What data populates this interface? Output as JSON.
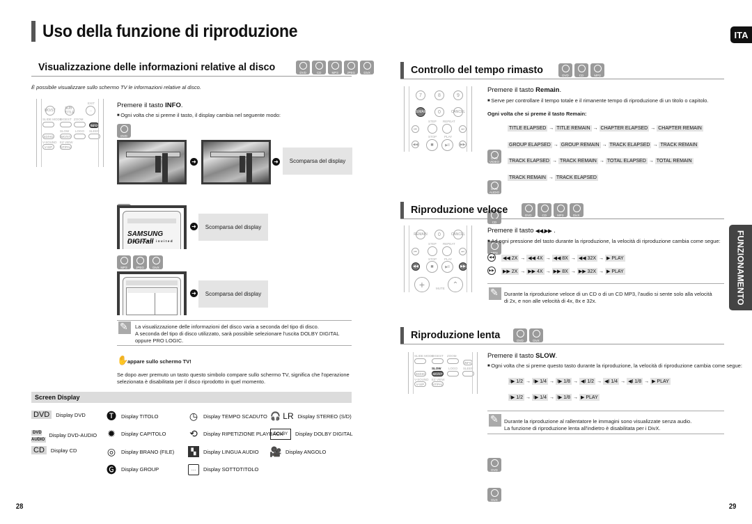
{
  "page": {
    "title": "Uso della funzione di riproduzione",
    "lang_tab": "ITA",
    "side_tab": "FUNZIONAMENTO",
    "page_left": "28",
    "page_right": "29"
  },
  "info_section": {
    "title": "Visualizzazione delle informazioni relative al disco",
    "discs": [
      "DVD",
      "CD",
      "MP3",
      "JPEG",
      "DivX"
    ],
    "intro": "È possibile visualizzare sullo schermo TV le informazioni relative al disco.",
    "press_prefix": "Premere il tasto ",
    "press_key": "INFO",
    "press_suffix": ".",
    "bullet": "Ogni volta che si preme il tasto, il display cambia nel seguente modo:",
    "dvd_label": "DVD",
    "cd_label": "CD",
    "mp3_discs": [
      "MP3",
      "JPEG",
      "DivX"
    ],
    "disappear": "Scomparsa del display",
    "samsung_logo": "SAMSUNG DIGITall",
    "samsung_tagline": "everyone's invited",
    "remote": {
      "mo_st": "MO/ST",
      "subtitle": "SUB TITLE",
      "exit": "EXIT",
      "slide_mode": "SLIDE MODE",
      "digest": "DIGEST",
      "zoom": "ZOOM",
      "info": "INFO",
      "tuner_memory": "TUNER MEMORY",
      "slow": "SLOW",
      "logo": "LOGO",
      "sleep": "SLEEP",
      "sd_hd": "SD/HD",
      "mo_st2": "MO/ST",
      "v_sound": "V-SOUND",
      "ez_view": "EZ VIEW",
      "v_sp": "V-S/P",
      "ntpal": "NT/PAL"
    },
    "notes": [
      "La visualizzazione delle informazioni del disco varia a seconda del tipo di disco.",
      "A seconda del tipo di disco utilizzato, sarà possibile selezionare l'uscita DOLBY DIGITAL oppure PRO LOGIC."
    ],
    "hand_title": "appare sullo schermo TV!",
    "hand_text": "Se dopo aver premuto un tasto questo simbolo compare sullo schermo TV, significa che l'operazione selezionata è disabilitata per il disco riprodotto in quel momento."
  },
  "screen_display": {
    "title": "Screen Display",
    "items": [
      {
        "icon": "DVD",
        "label": "Display DVD"
      },
      {
        "icon": "DVD AUDIO",
        "label": "Display DVD-AUDIO"
      },
      {
        "icon": "CD",
        "label": "Display CD"
      },
      {
        "icon": "title-icon",
        "label": "Display TITOLO"
      },
      {
        "icon": "chapter-icon",
        "label": "Display CAPITOLO"
      },
      {
        "icon": "track-icon",
        "label": "Display BRANO (FILE)"
      },
      {
        "icon": "group-icon",
        "label": "Display GROUP"
      },
      {
        "icon": "clock-icon",
        "label": "Display TEMPO SCADUTO"
      },
      {
        "icon": "repeat-icon",
        "label": "Display RIPETIZIONE PLAYBACK"
      },
      {
        "icon": "audio-language-icon",
        "label": "Display LINGUA AUDIO"
      },
      {
        "icon": "subtitle-icon",
        "label": "Display SOTTOTITOLO"
      },
      {
        "icon": "LR",
        "label": "Display STEREO (S/D)"
      },
      {
        "icon": "dolby-digital-icon",
        "label": "Display DOLBY DIGITAL"
      },
      {
        "icon": "camera-icon",
        "label": "Display ANGOLO"
      }
    ]
  },
  "remain_section": {
    "title": "Controllo del tempo rimasto",
    "discs": [
      "DVD",
      "CD",
      "MP3"
    ],
    "press_prefix": "Premere il tasto ",
    "press_key": "Remain",
    "press_suffix": ".",
    "bullet": "Serve per controllare il tempo totale e il rimanente tempo di riproduzione di un titolo o capitolo.",
    "subhead": "Ogni volta che si preme il tasto Remain:",
    "rows": [
      {
        "disc": "DVD VIDEO",
        "steps": [
          "TITLE ELAPSED",
          "TITLE REMAIN",
          "CHAPTER ELAPSED",
          "CHAPTER REMAIN"
        ]
      },
      {
        "disc": "DVD AUDIO",
        "steps": [
          "GROUP ELAPSED",
          "GROUP REMAIN",
          "TRACK ELAPSED",
          "TRACK REMAIN"
        ]
      },
      {
        "disc": "CD",
        "steps": [
          "TRACK ELAPSED",
          "TRACK REMAIN",
          "TOTAL ELAPSED",
          "TOTAL REMAIN"
        ]
      },
      {
        "disc": "MP3",
        "steps": [
          "TRACK REMAIN",
          "TRACK ELAPSED"
        ]
      }
    ],
    "remote": {
      "k7": "7",
      "k8": "8",
      "k9": "9",
      "remain": "REMAIN",
      "k0": "0",
      "cancel": "CANCEL",
      "step": "STEP",
      "repeat": "REPEAT",
      "stop": "STOP",
      "play": "PLAY"
    }
  },
  "fast_section": {
    "title": "Riproduzione veloce",
    "discs": [
      "DVD",
      "CD",
      "MP3",
      "DivX"
    ],
    "press_prefix": "Premere il tasto ",
    "press_key": "◀◀,▶▶",
    "press_suffix": " .",
    "bullet": "Ad ogni pressione del tasto durante la riproduzione, la velocità di riproduzione cambia come segue:",
    "rew_steps": [
      "◀◀ 2X",
      "◀◀ 4X",
      "◀◀ 8X",
      "◀◀ 32X",
      "▶ PLAY"
    ],
    "ff_steps": [
      "▶▶ 2X",
      "▶▶ 4X",
      "▶▶ 8X",
      "▶▶ 32X",
      "▶ PLAY"
    ],
    "note": "Durante la riproduzione veloce di un CD o di un CD MP3, l'audio si sente solo alla velocità di 2x, e non alle velocità di 4x, 8x e 32x.",
    "remote": {
      "remain": "REMAIN",
      "k0": "0",
      "cancel": "CANCEL",
      "step": "STEP",
      "repeat": "REPEAT",
      "stop": "STOP",
      "play": "PLAY",
      "mute": "MUTE"
    }
  },
  "slow_section": {
    "title": "Riproduzione lenta",
    "discs": [
      "DVD",
      "DivX"
    ],
    "press_prefix": "Premere il tasto ",
    "press_key": "SLOW",
    "press_suffix": ".",
    "bullet": "Ogni volta che si preme questo tasto durante la riproduzione, la velocità di riproduzione cambia come segue:",
    "dvd_steps": [
      "I▶ 1/2",
      "I▶ 1/4",
      "I▶ 1/8",
      "◀I 1/2",
      "◀I 1/4",
      "◀I 1/8",
      "▶ PLAY"
    ],
    "divx_steps": [
      "I▶ 1/2",
      "I▶ 1/4",
      "I▶ 1/8",
      "▶ PLAY"
    ],
    "notes": [
      "Durante la riproduzione al rallentatore le immagini sono visualizzate senza audio.",
      "La funzione di riproduzione lenta all'indietro è disabilitata per i DivX."
    ]
  }
}
